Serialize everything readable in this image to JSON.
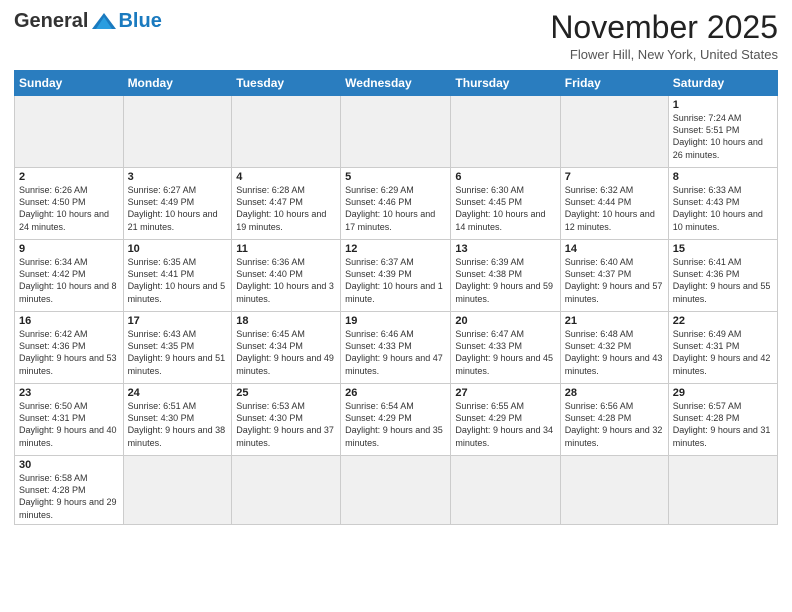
{
  "logo": {
    "general": "General",
    "blue": "Blue"
  },
  "header": {
    "month": "November 2025",
    "location": "Flower Hill, New York, United States"
  },
  "weekdays": [
    "Sunday",
    "Monday",
    "Tuesday",
    "Wednesday",
    "Thursday",
    "Friday",
    "Saturday"
  ],
  "weeks": [
    [
      {
        "day": "",
        "info": ""
      },
      {
        "day": "",
        "info": ""
      },
      {
        "day": "",
        "info": ""
      },
      {
        "day": "",
        "info": ""
      },
      {
        "day": "",
        "info": ""
      },
      {
        "day": "",
        "info": ""
      },
      {
        "day": "1",
        "info": "Sunrise: 7:24 AM\nSunset: 5:51 PM\nDaylight: 10 hours and 26 minutes."
      }
    ],
    [
      {
        "day": "2",
        "info": "Sunrise: 6:26 AM\nSunset: 4:50 PM\nDaylight: 10 hours and 24 minutes."
      },
      {
        "day": "3",
        "info": "Sunrise: 6:27 AM\nSunset: 4:49 PM\nDaylight: 10 hours and 21 minutes."
      },
      {
        "day": "4",
        "info": "Sunrise: 6:28 AM\nSunset: 4:47 PM\nDaylight: 10 hours and 19 minutes."
      },
      {
        "day": "5",
        "info": "Sunrise: 6:29 AM\nSunset: 4:46 PM\nDaylight: 10 hours and 17 minutes."
      },
      {
        "day": "6",
        "info": "Sunrise: 6:30 AM\nSunset: 4:45 PM\nDaylight: 10 hours and 14 minutes."
      },
      {
        "day": "7",
        "info": "Sunrise: 6:32 AM\nSunset: 4:44 PM\nDaylight: 10 hours and 12 minutes."
      },
      {
        "day": "8",
        "info": "Sunrise: 6:33 AM\nSunset: 4:43 PM\nDaylight: 10 hours and 10 minutes."
      }
    ],
    [
      {
        "day": "9",
        "info": "Sunrise: 6:34 AM\nSunset: 4:42 PM\nDaylight: 10 hours and 8 minutes."
      },
      {
        "day": "10",
        "info": "Sunrise: 6:35 AM\nSunset: 4:41 PM\nDaylight: 10 hours and 5 minutes."
      },
      {
        "day": "11",
        "info": "Sunrise: 6:36 AM\nSunset: 4:40 PM\nDaylight: 10 hours and 3 minutes."
      },
      {
        "day": "12",
        "info": "Sunrise: 6:37 AM\nSunset: 4:39 PM\nDaylight: 10 hours and 1 minute."
      },
      {
        "day": "13",
        "info": "Sunrise: 6:39 AM\nSunset: 4:38 PM\nDaylight: 9 hours and 59 minutes."
      },
      {
        "day": "14",
        "info": "Sunrise: 6:40 AM\nSunset: 4:37 PM\nDaylight: 9 hours and 57 minutes."
      },
      {
        "day": "15",
        "info": "Sunrise: 6:41 AM\nSunset: 4:36 PM\nDaylight: 9 hours and 55 minutes."
      }
    ],
    [
      {
        "day": "16",
        "info": "Sunrise: 6:42 AM\nSunset: 4:36 PM\nDaylight: 9 hours and 53 minutes."
      },
      {
        "day": "17",
        "info": "Sunrise: 6:43 AM\nSunset: 4:35 PM\nDaylight: 9 hours and 51 minutes."
      },
      {
        "day": "18",
        "info": "Sunrise: 6:45 AM\nSunset: 4:34 PM\nDaylight: 9 hours and 49 minutes."
      },
      {
        "day": "19",
        "info": "Sunrise: 6:46 AM\nSunset: 4:33 PM\nDaylight: 9 hours and 47 minutes."
      },
      {
        "day": "20",
        "info": "Sunrise: 6:47 AM\nSunset: 4:33 PM\nDaylight: 9 hours and 45 minutes."
      },
      {
        "day": "21",
        "info": "Sunrise: 6:48 AM\nSunset: 4:32 PM\nDaylight: 9 hours and 43 minutes."
      },
      {
        "day": "22",
        "info": "Sunrise: 6:49 AM\nSunset: 4:31 PM\nDaylight: 9 hours and 42 minutes."
      }
    ],
    [
      {
        "day": "23",
        "info": "Sunrise: 6:50 AM\nSunset: 4:31 PM\nDaylight: 9 hours and 40 minutes."
      },
      {
        "day": "24",
        "info": "Sunrise: 6:51 AM\nSunset: 4:30 PM\nDaylight: 9 hours and 38 minutes."
      },
      {
        "day": "25",
        "info": "Sunrise: 6:53 AM\nSunset: 4:30 PM\nDaylight: 9 hours and 37 minutes."
      },
      {
        "day": "26",
        "info": "Sunrise: 6:54 AM\nSunset: 4:29 PM\nDaylight: 9 hours and 35 minutes."
      },
      {
        "day": "27",
        "info": "Sunrise: 6:55 AM\nSunset: 4:29 PM\nDaylight: 9 hours and 34 minutes."
      },
      {
        "day": "28",
        "info": "Sunrise: 6:56 AM\nSunset: 4:28 PM\nDaylight: 9 hours and 32 minutes."
      },
      {
        "day": "29",
        "info": "Sunrise: 6:57 AM\nSunset: 4:28 PM\nDaylight: 9 hours and 31 minutes."
      }
    ],
    [
      {
        "day": "30",
        "info": "Sunrise: 6:58 AM\nSunset: 4:28 PM\nDaylight: 9 hours and 29 minutes."
      },
      {
        "day": "",
        "info": ""
      },
      {
        "day": "",
        "info": ""
      },
      {
        "day": "",
        "info": ""
      },
      {
        "day": "",
        "info": ""
      },
      {
        "day": "",
        "info": ""
      },
      {
        "day": "",
        "info": ""
      }
    ]
  ]
}
